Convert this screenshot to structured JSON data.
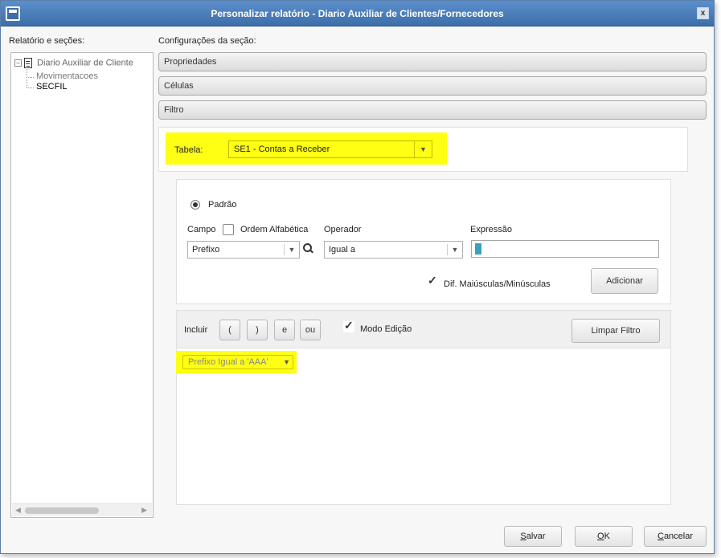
{
  "window": {
    "title": "Personalizar relatório - Diario Auxiliar de Clientes/Fornecedores",
    "close_label": "x",
    "title_color": "#3d6fa9"
  },
  "left_panel": {
    "heading": "Relatório e seções:",
    "tree": {
      "root_expander": "−",
      "root_label": "Diario Auxiliar de Cliente",
      "children": [
        "Movimentacoes",
        "SECFIL"
      ]
    }
  },
  "right_panel": {
    "heading": "Configurações da seção:",
    "sections": [
      "Propriedades",
      "Células",
      "Filtro"
    ]
  },
  "tabela": {
    "label": "Tabela:",
    "value": "SE1 - Contas a Receber",
    "highlight_color": "#ffff14"
  },
  "filtro": {
    "radio_label": "Padrão",
    "campo_label": "Campo",
    "ordem_label": "Ordem Alfabética",
    "operador_label": "Operador",
    "expressao_label": "Expressão",
    "campo_value": "Prefixo",
    "operador_value": "Igual a",
    "expressao_value": "",
    "dif_label": "Dif. Maiúsculas/Minúsculas",
    "adicionar_label": "Adicionar"
  },
  "toolbar": {
    "incluir_label": "Incluir",
    "buttons": [
      "(",
      ")",
      "e",
      "ou"
    ],
    "modo_edicao_label": "Modo Edição",
    "limpar_label": "Limpar Filtro"
  },
  "result": {
    "chip_label": "Prefixo Igual a 'AAA'"
  },
  "footer": {
    "salvar": {
      "pre": "",
      "u": "S",
      "post": "alvar"
    },
    "ok": {
      "pre": "",
      "u": "O",
      "post": "K"
    },
    "cancelar": {
      "pre": "",
      "u": "C",
      "post": "ancelar"
    }
  }
}
